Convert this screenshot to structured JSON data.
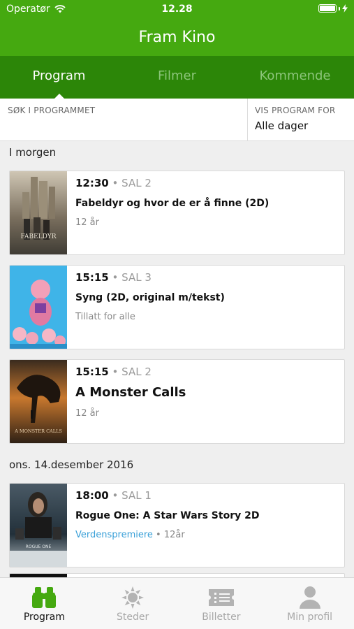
{
  "status_bar": {
    "carrier": "Operatør",
    "time": "12.28",
    "battery_level": 1.0
  },
  "navbar": {
    "title": "Fram Kino"
  },
  "top_tabs": [
    {
      "label": "Program",
      "active": true
    },
    {
      "label": "Filmer",
      "active": false
    },
    {
      "label": "Kommende",
      "active": false
    }
  ],
  "filter": {
    "search_label": "SØK I PROGRAMMET",
    "search_value": "",
    "days_label": "VIS PROGRAM FOR",
    "days_value": "Alle dager"
  },
  "sections": [
    {
      "header": "I morgen",
      "screenings": [
        {
          "time": "12:30",
          "hall": "SAL 2",
          "title": "Fabeldyr og hvor de er å finne (2D)",
          "rating": "12 år",
          "badge": ""
        },
        {
          "time": "15:15",
          "hall": "SAL 3",
          "title": "Syng (2D, original m/tekst)",
          "rating": "Tillatt for alle",
          "badge": ""
        },
        {
          "time": "15:15",
          "hall": "SAL 2",
          "title": "A Monster Calls",
          "rating": "12 år",
          "badge": ""
        }
      ]
    },
    {
      "header": "ons. 14.desember 2016",
      "screenings": [
        {
          "time": "18:00",
          "hall": "SAL 1",
          "title": "Rogue One: A Star Wars Story 2D",
          "rating": "12år",
          "badge": "Verdenspremiere"
        }
      ]
    }
  ],
  "tab_bar": [
    {
      "label": "Program",
      "icon": "binoculars-icon",
      "active": true
    },
    {
      "label": "Steder",
      "icon": "sun-icon",
      "active": false
    },
    {
      "label": "Billetter",
      "icon": "ticket-icon",
      "active": false
    },
    {
      "label": "Min profil",
      "icon": "person-icon",
      "active": false
    }
  ],
  "colors": {
    "brand_green": "#45a910",
    "tab_green": "#2c8608",
    "link_blue": "#3aa0d8"
  }
}
